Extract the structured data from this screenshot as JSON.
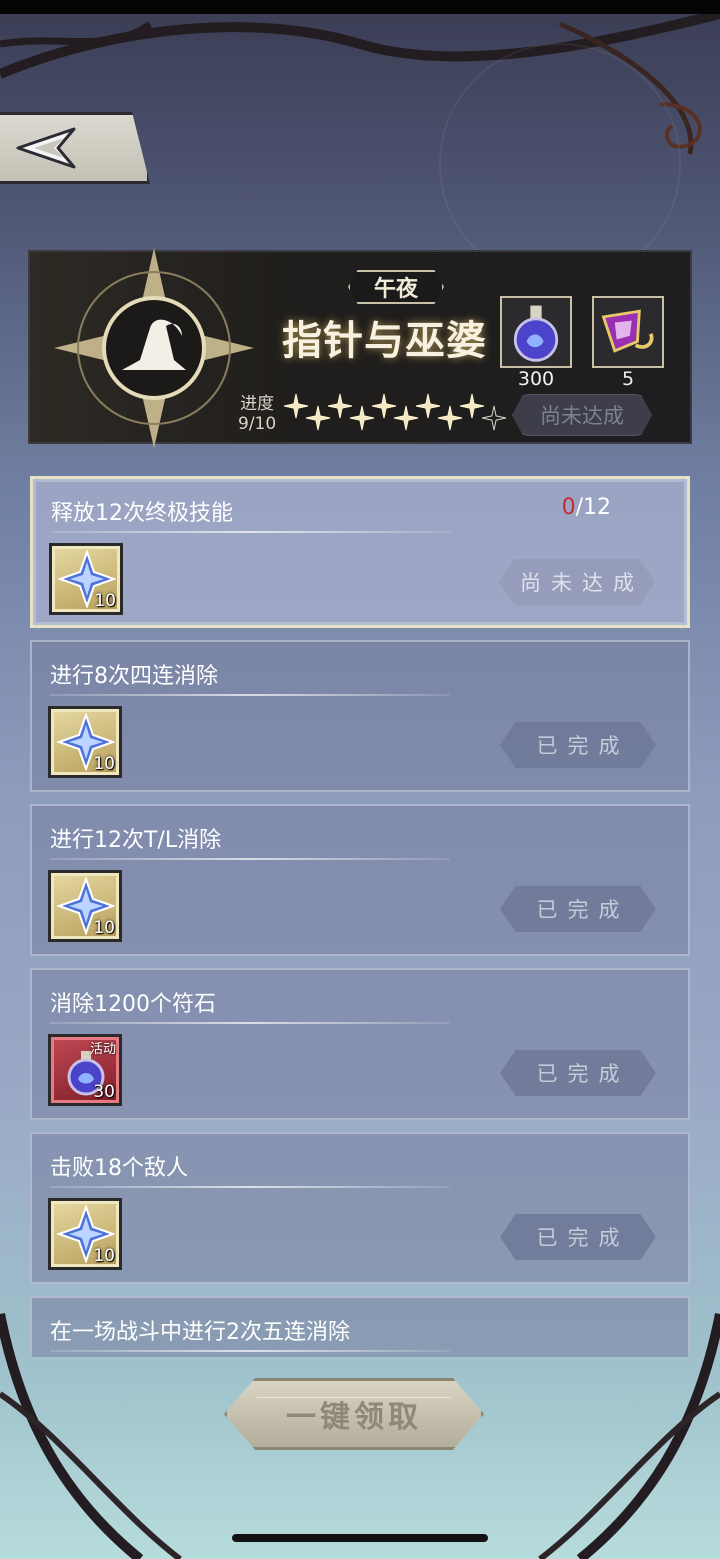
{
  "banner": {
    "subtitle": "午夜",
    "title": "指针与巫婆",
    "rewards": [
      {
        "icon": "blue-potion-icon",
        "count": "300"
      },
      {
        "icon": "purple-scroll-icon",
        "count": "5"
      }
    ],
    "progress_label": "进度",
    "progress_value": "9/10",
    "stars_filled": 9,
    "stars_total": 10,
    "status": "尚未达成"
  },
  "quests": [
    {
      "title": "释放12次终极技能",
      "progress_current": "0",
      "progress_total": "/12",
      "reward_icon": "star-crystal-icon",
      "reward_qty": "10",
      "status": "尚未达成",
      "active": true
    },
    {
      "title": "进行8次四连消除",
      "reward_icon": "star-crystal-icon",
      "reward_qty": "10",
      "status": "已完成"
    },
    {
      "title": "进行12次T/L消除",
      "reward_icon": "star-crystal-icon",
      "reward_qty": "10",
      "status": "已完成"
    },
    {
      "title": "消除1200个符石",
      "reward_icon": "blue-potion-icon",
      "reward_qty": "30",
      "reward_tag": "活动",
      "status": "已完成"
    },
    {
      "title": "击败18个敌人",
      "reward_icon": "star-crystal-icon",
      "reward_qty": "10",
      "status": "已完成"
    },
    {
      "title": "在一场战斗中进行2次五连消除"
    }
  ],
  "claim_all_label": "一键领取",
  "colors": {
    "accent_red": "#c22d2d",
    "gold": "#e7e2c6"
  }
}
